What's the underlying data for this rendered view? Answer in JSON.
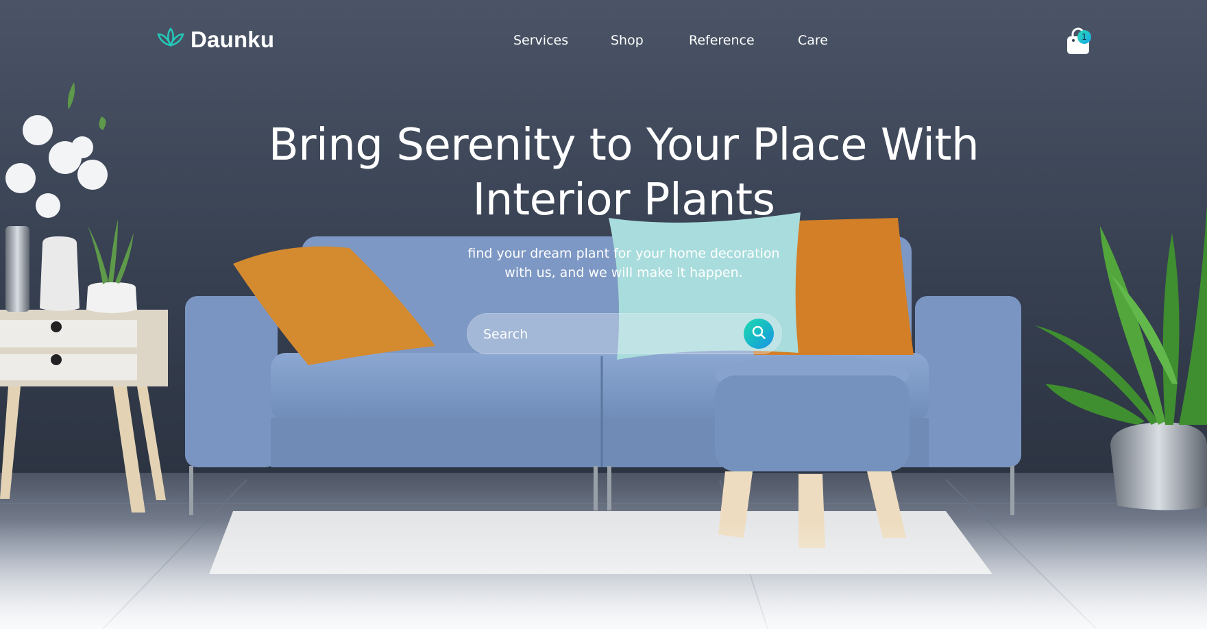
{
  "brand": {
    "name": "Daunku",
    "logo_icon": "lotus-icon",
    "accent": "#23c9b8"
  },
  "nav": {
    "items": [
      {
        "label": "Services"
      },
      {
        "label": "Shop"
      },
      {
        "label": "Reference"
      },
      {
        "label": "Care"
      }
    ],
    "cart": {
      "icon": "shopping-bag-icon",
      "count": "1"
    }
  },
  "hero": {
    "title_line1": "Bring Serenity to Your Place With",
    "title_line2": "Interior Plants",
    "subtitle_line1": "find your dream plant for your home decoration",
    "subtitle_line2": "with us, and we will make it happen.",
    "search": {
      "placeholder": "Search",
      "value": "",
      "button_icon": "search-icon"
    }
  },
  "colors": {
    "wall": "#3b4556",
    "sofa": "#7f9cc8",
    "pillow_orange": "#d58a2e",
    "pillow_teal": "#a8dcdc",
    "floor": "#9aa4b3"
  }
}
